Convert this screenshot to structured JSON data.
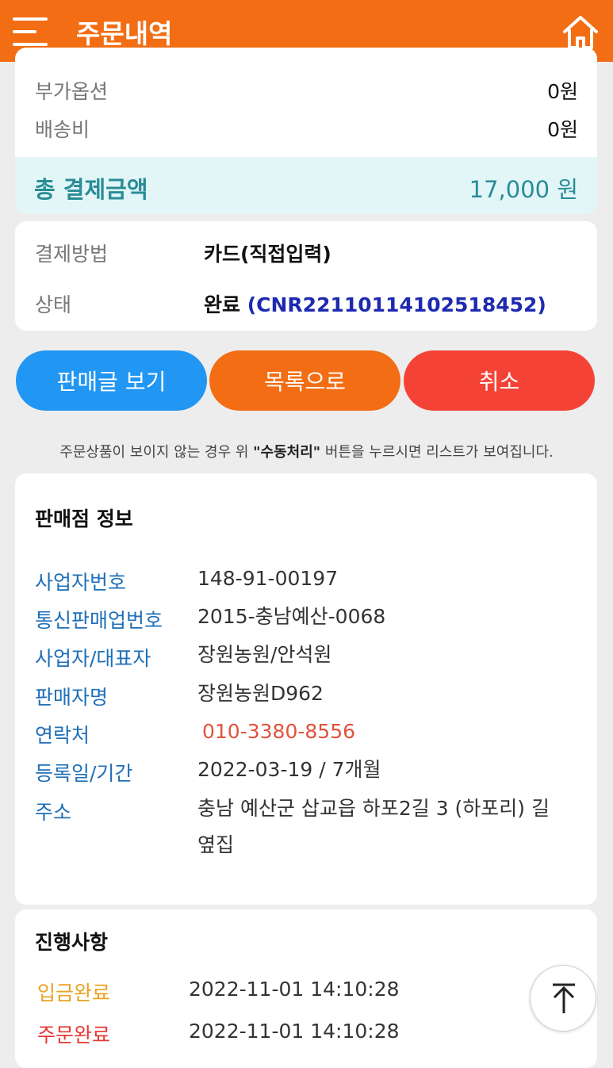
{
  "header": {
    "title": "주문내역",
    "menu_icon": "hamburger-icon",
    "home_icon": "home-icon"
  },
  "payment_summary": {
    "option_label": "부가옵션",
    "option_value": "0원",
    "shipping_label": "배송비",
    "shipping_value": "0원",
    "total_label": "총 결제금액",
    "total_value": "17,000 원"
  },
  "payment_info": {
    "method_label": "결제방법",
    "method_value": "카드(직접입력)",
    "status_label": "상태",
    "status_value": "완료",
    "status_code": "(CNR22110114102518452)"
  },
  "actions": {
    "view_post": "판매글 보기",
    "to_list": "목록으로",
    "cancel": "취소"
  },
  "notice": {
    "before": "주문상품이 보이지 않는 경우 위 ",
    "highlight": "\"수동처리\"",
    "after": " 버튼을 누르시면 리스트가 보여집니다."
  },
  "seller": {
    "title": "판매점 정보",
    "rows": [
      {
        "label": "사업자번호",
        "value": "148-91-00197"
      },
      {
        "label": "통신판매업번호",
        "value": "2015-충남예산-0068"
      },
      {
        "label": "사업자/대표자",
        "value": "장원농원/안석원"
      },
      {
        "label": "판매자명",
        "value": "장원농원D962"
      },
      {
        "label": "연락처",
        "value": "010-3380-8556"
      },
      {
        "label": "등록일/기간",
        "value": "2022-03-19 / 7개월"
      },
      {
        "label": "주소",
        "value": "충남 예산군 삽교읍 하포2길 3 (하포리) 길옆집"
      }
    ]
  },
  "progress": {
    "title": "진행사항",
    "items": [
      {
        "label": "입금완료",
        "time": "2022-11-01 14:10:28",
        "color": "#e8a321"
      },
      {
        "label": "주문완료",
        "time": "2022-11-01 14:10:28",
        "color": "#e53935"
      }
    ]
  },
  "colors": {
    "accent": "#f26d13",
    "blue": "#2196f3",
    "red": "#f44336",
    "teal": "#2a8c96"
  }
}
